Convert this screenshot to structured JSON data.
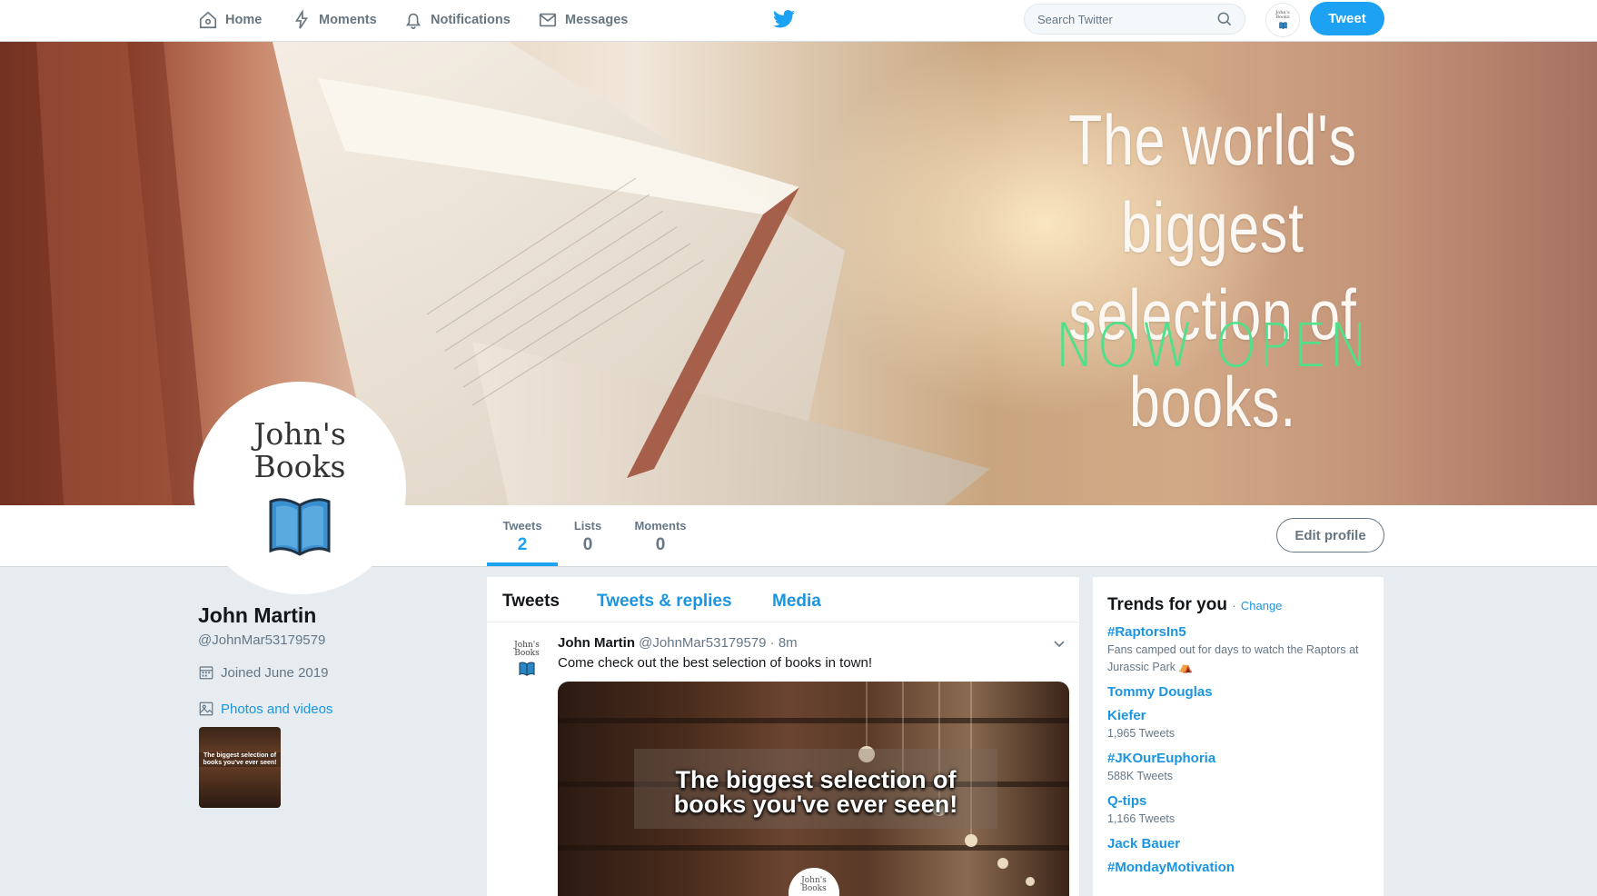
{
  "nav": {
    "home": "Home",
    "moments": "Moments",
    "notifications": "Notifications",
    "messages": "Messages",
    "search_placeholder": "Search Twitter",
    "tweet_button": "Tweet",
    "avatar_text_line1": "John's",
    "avatar_text_line2": "Books",
    "brand_icon": "twitter-bird-icon"
  },
  "banner": {
    "headline_line1": "The world's biggest",
    "headline_line2": "selection of books.",
    "subline": "NOW OPEN",
    "headline_color": "#fbf7f2",
    "subline_color": "#4fe08a"
  },
  "profile": {
    "logo_line1": "John's",
    "logo_line2": "Books",
    "name": "John Martin",
    "handle": "@JohnMar53179579",
    "joined": "Joined June 2019",
    "photos_link": "Photos and videos",
    "thumb_caption": "The biggest selection of books you've ever seen!"
  },
  "stats": {
    "tweets_label": "Tweets",
    "tweets_value": "2",
    "lists_label": "Lists",
    "lists_value": "0",
    "moments_label": "Moments",
    "moments_value": "0",
    "edit_profile": "Edit profile"
  },
  "timeline": {
    "tabs": [
      "Tweets",
      "Tweets & replies",
      "Media"
    ],
    "tweet": {
      "author": "John Martin",
      "meta": "@JohnMar53179579 · 8m",
      "text": "Come check out the best selection of books in town!",
      "media_caption_line1": "The biggest selection of",
      "media_caption_line2": "books you've ever seen!",
      "avatar_line1": "John's",
      "avatar_line2": "Books"
    }
  },
  "trends": {
    "title": "Trends for you",
    "change": "Change",
    "items": [
      {
        "name": "#RaptorsIn5",
        "desc": "Fans camped out for days to watch the Raptors at Jurassic Park ⛺"
      },
      {
        "name": "Tommy Douglas",
        "desc": ""
      },
      {
        "name": "Kiefer",
        "desc": "1,965 Tweets"
      },
      {
        "name": "#JKOurEuphoria",
        "desc": "588K Tweets"
      },
      {
        "name": "Q-tips",
        "desc": "1,166 Tweets"
      },
      {
        "name": "Jack Bauer",
        "desc": ""
      },
      {
        "name": "#MondayMotivation",
        "desc": ""
      }
    ]
  },
  "colors": {
    "accent": "#1da1f2",
    "link": "#1b95e0",
    "page_bg": "#e6ecf0",
    "secondary_text": "#657786"
  }
}
